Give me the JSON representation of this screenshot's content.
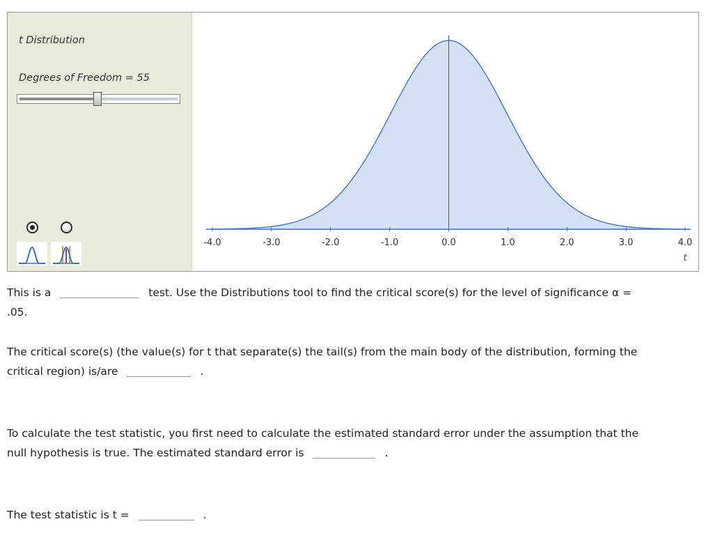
{
  "tool": {
    "panel_title": "t Distribution",
    "df_label": "Degrees of Freedom = 55",
    "df_value": 55,
    "slider_fraction": 0.495,
    "radio_options": [
      {
        "name": "single-curve-mode",
        "checked": true
      },
      {
        "name": "critical-region-mode",
        "checked": false
      }
    ],
    "icons": [
      "bell-curve-icon",
      "critical-region-curve-icon"
    ],
    "colors": {
      "panel_bg": "#ebebdd",
      "curve": "#3a6fcf",
      "curve_fill": "#d4e0f4",
      "marker_orange": "#e8a020",
      "marker_purple": "#7a3fb0"
    }
  },
  "chart_data": {
    "type": "area",
    "distribution": "t",
    "df": 55,
    "x_ticks": [
      "-4.0",
      "-3.0",
      "-2.0",
      "-1.0",
      "0.0",
      "1.0",
      "2.0",
      "3.0",
      "4.0"
    ],
    "xlim": [
      -4.0,
      4.0
    ],
    "xlabel": "t",
    "center_line": 0.0
  },
  "questions": {
    "q1_before": "This is a",
    "q1_after": "test. Use the Distributions tool to find the critical score(s) for the level of significance α =",
    "q1_line2": ".05.",
    "q2_line1": "The critical score(s) (the value(s) for t that separate(s) the tail(s) from the main body of the distribution, forming the",
    "q2_line2": "critical region) is/are",
    "q3_line1": "To calculate the test statistic, you first need to calculate the estimated standard error under the assumption that the",
    "q3_line2": "null hypothesis is true. The estimated standard error is",
    "q4": "The test statistic is t =",
    "period": "."
  }
}
